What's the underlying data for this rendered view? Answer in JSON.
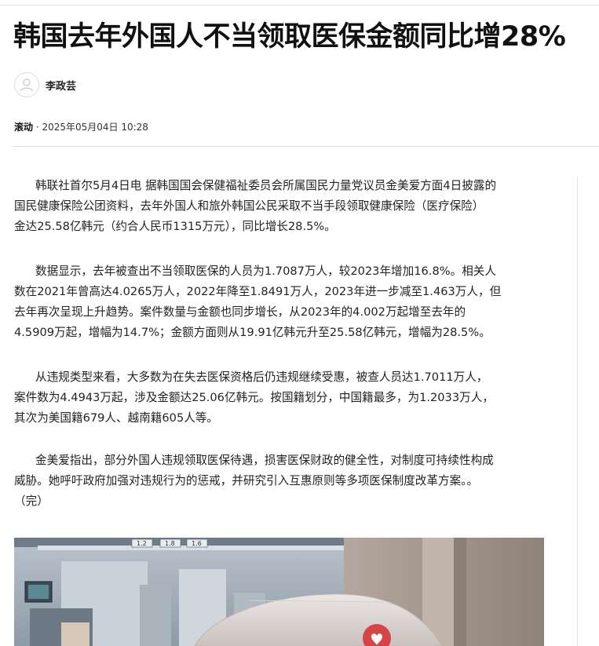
{
  "article": {
    "title": "韩国去年外国人不当领取医保金额同比增28%",
    "author": "李政芸",
    "channel": "滚动",
    "separator": " · ",
    "datetime": "2025年05月04日 10:28",
    "paragraphs": [
      "韩联社首尔5月4日电 据韩国国会保健福祉委员会所属国民力量党议员金美爱方面4日披露的\n国民健康保险公团资料，去年外国人和旅外韩国公民采取不当手段领取健康保险（医疗保险）\n金达25.58亿韩元（约合人民币1315万元），同比增长28.5%。",
      "数据显示，去年被查出不当领取医保的人员为1.7087万人，较2023年增加16.8%。相关人\n数在2021年曾高达4.0265万人，2022年降至1.8491万人，2023年进一步减至1.463万人，但\n去年再次呈现上升趋势。案件数量与金额也同步增长，从2023年的4.002万起增至去年的\n4.5909万起，增幅为14.7%；金额方面则从19.91亿韩元升至25.58亿韩元，增幅为28.5%。",
      "从违规类型来看，大多数为在失去医保资格后仍违规继续受惠，被查人员达1.7011万人，\n案件数为4.4943万起，涉及金额达25.06亿韩元。按国籍划分，中国籍最多，为1.2033万人，\n其次为美国籍679人、越南籍605人等。",
      "金美爱指出，部分外国人违规领取医保待遇，损害医保财政的健全性，对制度可持续性构成\n威胁。她呼吁政府加强对违规行为的惩戒，并研究引入互惠原则等多项医保制度改革方案。。\n（完）"
    ]
  },
  "photo": {
    "sign_labels": [
      "1.2",
      "1.8",
      "1.6"
    ]
  },
  "colors": {
    "title": "#111111",
    "body_text": "#222222",
    "divider": "#dedede"
  }
}
